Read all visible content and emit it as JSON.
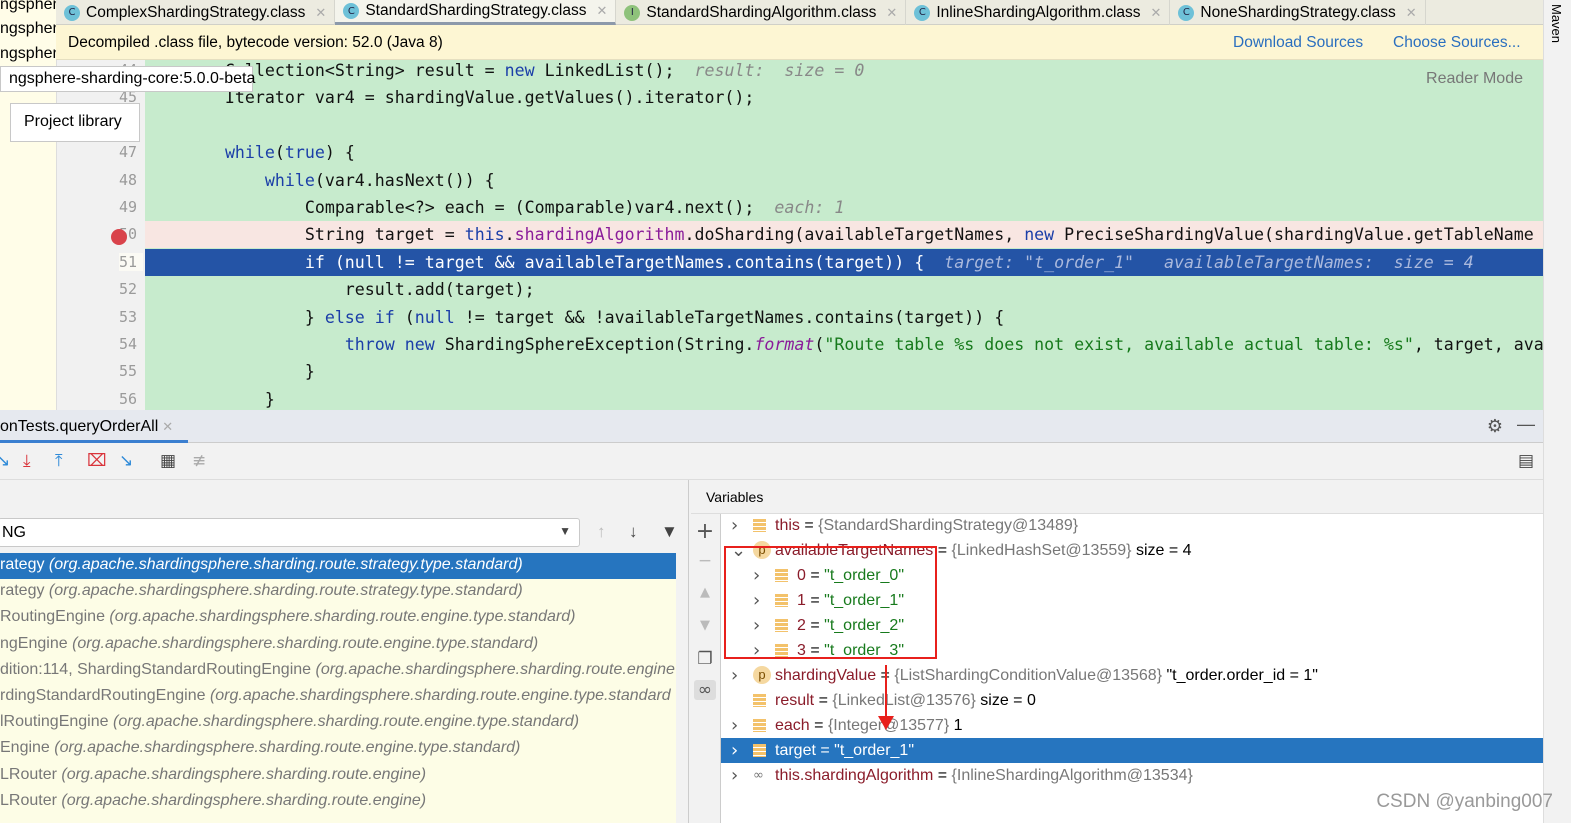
{
  "project_tree": [
    "ngsphen",
    "ngsphen",
    "ngsphen"
  ],
  "tabs": [
    {
      "label": "ComplexShardingStrategy.class",
      "icon": "class-icon",
      "active": false
    },
    {
      "label": "StandardShardingStrategy.class",
      "icon": "class-icon",
      "active": true
    },
    {
      "label": "StandardShardingAlgorithm.class",
      "icon": "interface-icon",
      "active": false
    },
    {
      "label": "InlineShardingAlgorithm.class",
      "icon": "class-icon",
      "active": false
    },
    {
      "label": "NoneShardingStrategy.class",
      "icon": "class-icon",
      "active": false
    }
  ],
  "banner": {
    "message": "Decompiled .class file, bytecode version: 52.0 (Java 8)",
    "download": "Download Sources",
    "choose": "Choose Sources..."
  },
  "reader_mode": "Reader Mode",
  "tooltip": {
    "library_path": "ngsphere-sharding-core:5.0.0-beta",
    "library_type": "Project library"
  },
  "editor": {
    "lines": [
      {
        "n": "44",
        "tokens": [
          {
            "t": "        Collection<String> result = "
          },
          {
            "t": "new",
            "c": "kw"
          },
          {
            "t": " LinkedList();  "
          },
          {
            "t": "result:  size = 0",
            "c": "hint"
          }
        ]
      },
      {
        "n": "45",
        "tokens": [
          {
            "t": "        Iterator var4 = shardingValue.getValues().iterator();"
          }
        ]
      },
      {
        "n": "46",
        "tokens": []
      },
      {
        "n": "47",
        "tokens": [
          {
            "t": "        "
          },
          {
            "t": "while",
            "c": "kw"
          },
          {
            "t": "("
          },
          {
            "t": "true",
            "c": "kw"
          },
          {
            "t": ") {"
          }
        ]
      },
      {
        "n": "48",
        "tokens": [
          {
            "t": "            "
          },
          {
            "t": "while",
            "c": "kw"
          },
          {
            "t": "(var4.hasNext()) {"
          }
        ]
      },
      {
        "n": "49",
        "tokens": [
          {
            "t": "                Comparable<?> each = (Comparable)var4.next();  "
          },
          {
            "t": "each: 1",
            "c": "hint"
          }
        ]
      },
      {
        "n": "50",
        "state": "breakpoint",
        "tokens": [
          {
            "t": "                String target = "
          },
          {
            "t": "this",
            "c": "kw"
          },
          {
            "t": "."
          },
          {
            "t": "shardingAlgorithm",
            "c": "fld"
          },
          {
            "t": ".doSharding(availableTargetNames, "
          },
          {
            "t": "new",
            "c": "kw"
          },
          {
            "t": " PreciseShardingValue(shardingValue.getTableName"
          }
        ]
      },
      {
        "n": "51",
        "state": "current",
        "tokens": [
          {
            "t": "                if (null != target && availableTargetNames.contains(target)) {  "
          },
          {
            "t": "target: \"t_order_1\"   availableTargetNames:  size = 4",
            "c": "hint"
          }
        ]
      },
      {
        "n": "52",
        "tokens": [
          {
            "t": "                    result.add(target);"
          }
        ]
      },
      {
        "n": "53",
        "tokens": [
          {
            "t": "                } "
          },
          {
            "t": "else if",
            "c": "kw"
          },
          {
            "t": " ("
          },
          {
            "t": "null",
            "c": "kw"
          },
          {
            "t": " != target && !availableTargetNames.contains(target)) {"
          }
        ]
      },
      {
        "n": "54",
        "tokens": [
          {
            "t": "                    "
          },
          {
            "t": "throw new",
            "c": "kw"
          },
          {
            "t": " ShardingSphereException(String."
          },
          {
            "t": "format",
            "c": "it fld"
          },
          {
            "t": "("
          },
          {
            "t": "\"Route table %s does not exist, available actual table: %s\"",
            "c": "str"
          },
          {
            "t": ", target, ava"
          }
        ]
      },
      {
        "n": "55",
        "tokens": [
          {
            "t": "                }"
          }
        ]
      },
      {
        "n": "56",
        "tokens": [
          {
            "t": "            }"
          }
        ]
      }
    ]
  },
  "debug": {
    "tab_label": "onTests.queryOrderAll",
    "thread_select": "NG",
    "frames": [
      {
        "name": "rategy",
        "pkg": "(org.apache.shardingsphere.sharding.route.strategy.type.standard)",
        "selected": true
      },
      {
        "name": "rategy",
        "pkg": "(org.apache.shardingsphere.sharding.route.strategy.type.standard)"
      },
      {
        "name": "RoutingEngine",
        "pkg": "(org.apache.shardingsphere.sharding.route.engine.type.standard)"
      },
      {
        "name": "ngEngine",
        "pkg": "(org.apache.shardingsphere.sharding.route.engine.type.standard)"
      },
      {
        "name": "dition:114, ShardingStandardRoutingEngine",
        "pkg": "(org.apache.shardingsphere.sharding.route.engine"
      },
      {
        "name": "rdingStandardRoutingEngine",
        "pkg": "(org.apache.shardingsphere.sharding.route.engine.type.standard"
      },
      {
        "name": "lRoutingEngine",
        "pkg": "(org.apache.shardingsphere.sharding.route.engine.type.standard)"
      },
      {
        "name": "Engine",
        "pkg": "(org.apache.shardingsphere.sharding.route.engine.type.standard)"
      },
      {
        "name": "LRouter",
        "pkg": "(org.apache.shardingsphere.sharding.route.engine)"
      },
      {
        "name": "LRouter",
        "pkg": "(org.apache.shardingsphere.sharding.route.engine)"
      }
    ],
    "variables_title": "Variables",
    "variables": [
      {
        "depth": 0,
        "chev": "right",
        "icon": "field",
        "name": "this",
        "type": "{StandardShardingStrategy@13489}",
        "value": ""
      },
      {
        "depth": 0,
        "chev": "down",
        "icon": "param",
        "name": "availableTargetNames",
        "type": "{LinkedHashSet@13559}",
        "value": "size = 4"
      },
      {
        "depth": 1,
        "chev": "right",
        "icon": "field",
        "name": "0",
        "str": "\"t_order_0\""
      },
      {
        "depth": 1,
        "chev": "right",
        "icon": "field",
        "name": "1",
        "str": "\"t_order_1\""
      },
      {
        "depth": 1,
        "chev": "right",
        "icon": "field",
        "name": "2",
        "str": "\"t_order_2\""
      },
      {
        "depth": 1,
        "chev": "right",
        "icon": "field",
        "name": "3",
        "str": "\"t_order_3\""
      },
      {
        "depth": 0,
        "chev": "right",
        "icon": "param",
        "name": "shardingValue",
        "type": "{ListShardingConditionValue@13568}",
        "value": "\"t_order.order_id = 1\""
      },
      {
        "depth": 0,
        "chev": "",
        "icon": "field",
        "name": "result",
        "type": "{LinkedList@13576}",
        "value": "size = 0"
      },
      {
        "depth": 0,
        "chev": "right",
        "icon": "field",
        "name": "each",
        "type": "{Integer@13577}",
        "value": "1"
      },
      {
        "depth": 0,
        "chev": "right",
        "icon": "field",
        "name": "target",
        "str": "\"t_order_1\"",
        "selected": true
      },
      {
        "depth": 0,
        "chev": "right",
        "icon": "watch",
        "name": "this.shardingAlgorithm",
        "type": "{InlineShardingAlgorithm@13534}",
        "value": ""
      }
    ]
  },
  "right_strip": "Maven",
  "watermark": "CSDN @yanbing007",
  "colors": {
    "selection": "#2675bf",
    "execution_line": "#2454a6",
    "annotation_red": "#e8201c",
    "editor_bg": "#c7ebcd"
  }
}
